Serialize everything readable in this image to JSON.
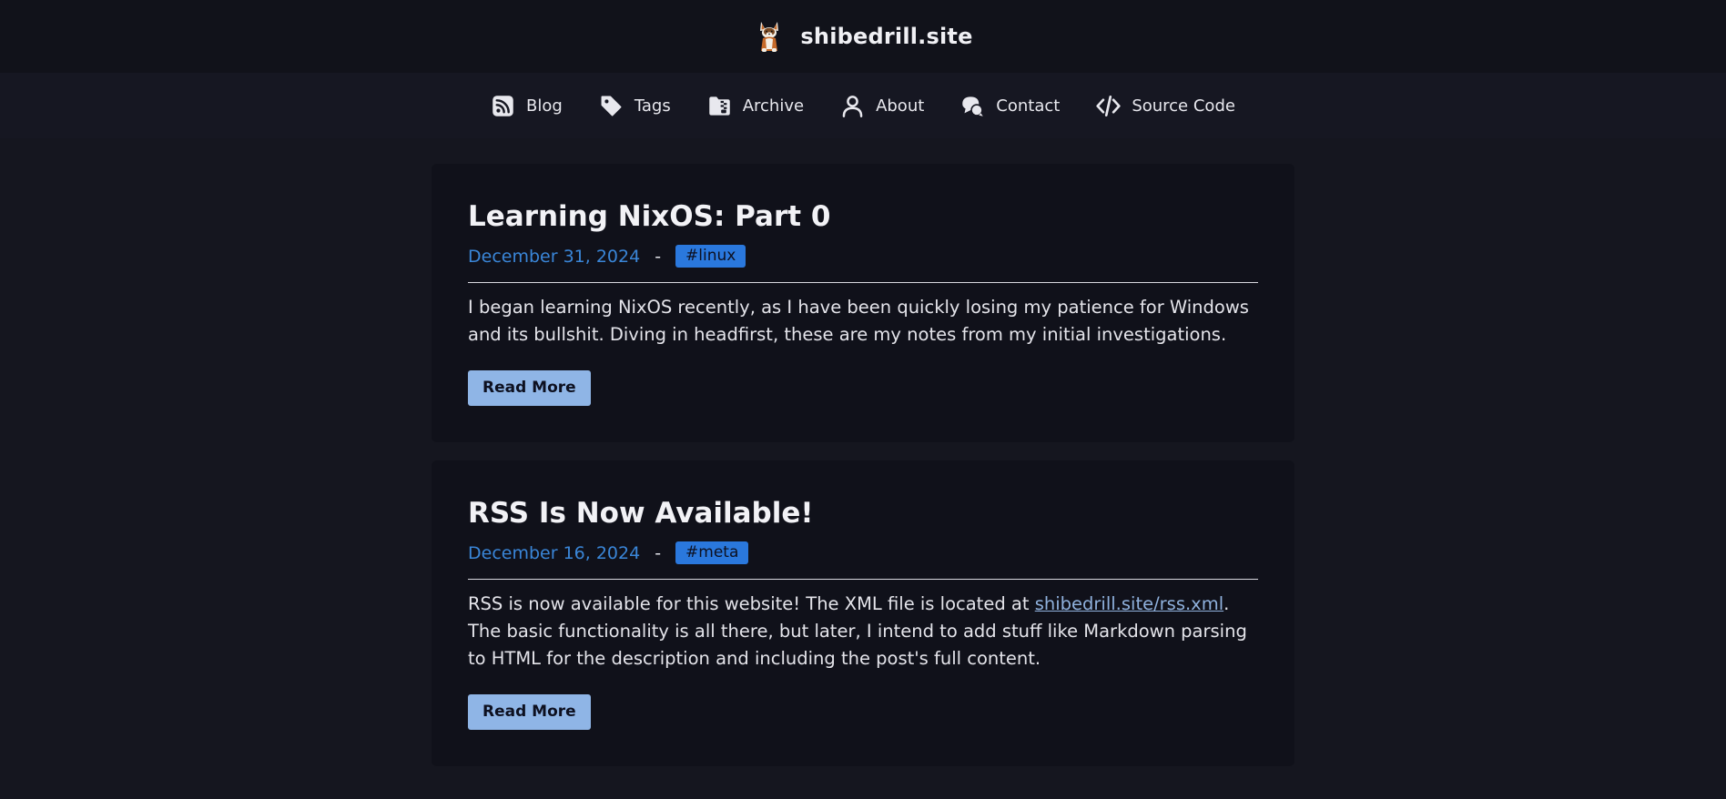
{
  "header": {
    "site_title": "shibedrill.site",
    "logo": "shiba-dog-logo"
  },
  "nav": {
    "items": [
      {
        "label": "Blog",
        "icon": "rss-icon"
      },
      {
        "label": "Tags",
        "icon": "tag-icon"
      },
      {
        "label": "Archive",
        "icon": "archive-file-icon"
      },
      {
        "label": "About",
        "icon": "user-icon"
      },
      {
        "label": "Contact",
        "icon": "chat-bubbles-icon"
      },
      {
        "label": "Source Code",
        "icon": "code-icon"
      }
    ]
  },
  "posts": [
    {
      "title": "Learning NixOS: Part 0",
      "date": "December 31, 2024",
      "separator": "-",
      "tag": "#linux",
      "description": "I began learning NixOS recently, as I have been quickly losing my patience for Windows and its bullshit. Diving in headfirst, these are my notes from my initial investigations.",
      "read_more": "Read More"
    },
    {
      "title": "RSS Is Now Available!",
      "date": "December 16, 2024",
      "separator": "-",
      "tag": "#meta",
      "description_before": "RSS is now available for this website! The XML file is located at ",
      "description_link": "shibedrill.site/rss.xml",
      "description_after": ". The basic functionality is all there, but later, I intend to add stuff like Markdown parsing to HTML for the description and including the post's full content.",
      "read_more": "Read More"
    }
  ],
  "colors": {
    "background": "#15161f",
    "header_bg": "#11121a",
    "nav_bg": "#161722",
    "card_bg": "#10111a",
    "accent_date": "#3a86d8",
    "tag_bg": "#2a78dd",
    "button_bg": "#8fb5e6",
    "link": "#8fb1dd"
  }
}
